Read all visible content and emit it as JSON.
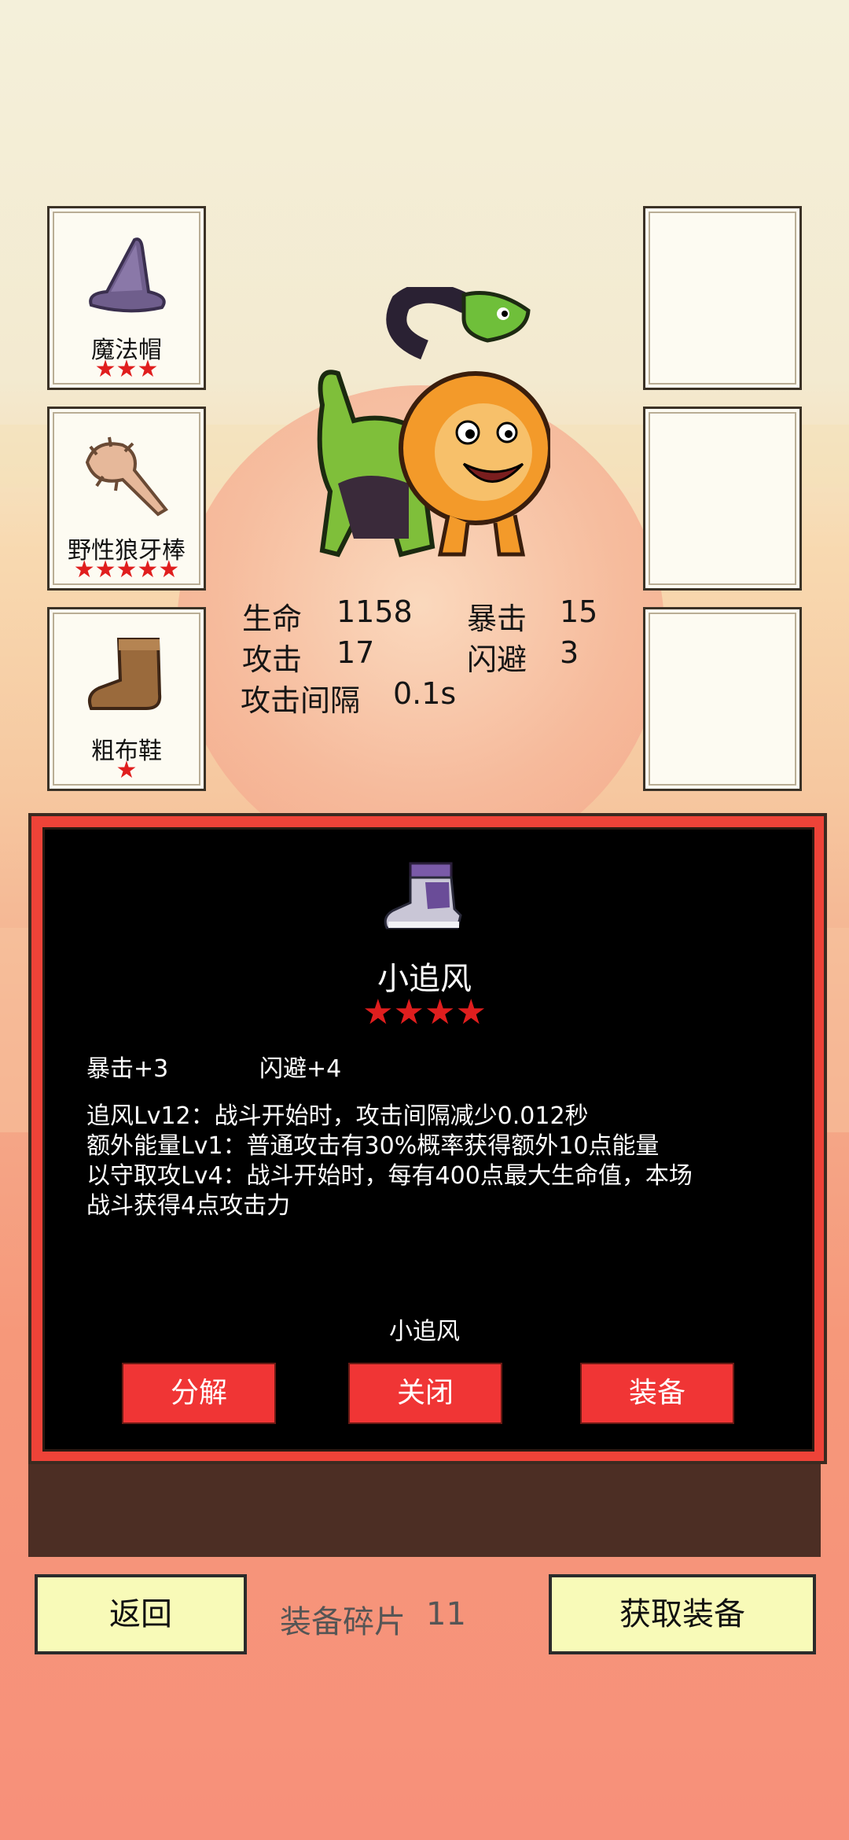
{
  "equipment_left": [
    {
      "name": "魔法帽",
      "stars": "★★★",
      "icon": "wizard-hat-icon"
    },
    {
      "name": "野性狼牙棒",
      "stars": "★★★★★",
      "icon": "spiked-club-icon"
    },
    {
      "name": "粗布鞋",
      "stars": "★",
      "icon": "cloth-boot-icon"
    }
  ],
  "character": {
    "icon": "chimera-lion-snake-icon"
  },
  "stats": {
    "hp_label": "生命",
    "hp_value": "1158",
    "crit_label": "暴击",
    "crit_value": "15",
    "atk_label": "攻击",
    "atk_value": "17",
    "dodge_label": "闪避",
    "dodge_value": "3",
    "interval_label": "攻击间隔",
    "interval_value": "0.1s"
  },
  "detail": {
    "item_icon": "purple-sneaker-icon",
    "title": "小追风",
    "stars": "★★★★",
    "attr1": "暴击+3",
    "attr2": "闪避+4",
    "desc": [
      "追风Lv12：战斗开始时，攻击间隔减少0.012秒",
      "额外能量Lv1：普通攻击有30%概率获得额外10点能量",
      "以守取攻Lv4：战斗开始时，每有400点最大生命值，本场",
      "战斗获得4点攻击力"
    ],
    "footer_name": "小追风",
    "btn_decompose": "分解",
    "btn_close": "关闭",
    "btn_equip": "装备"
  },
  "bottom": {
    "back": "返回",
    "fragments_label": "装备碎片",
    "fragments_value": "11",
    "get_equipment": "获取装备"
  },
  "colors": {
    "star": "#e01e1e",
    "panel_border": "#ee4338",
    "button_red": "#f03535",
    "button_yellow": "#f8fab8"
  }
}
